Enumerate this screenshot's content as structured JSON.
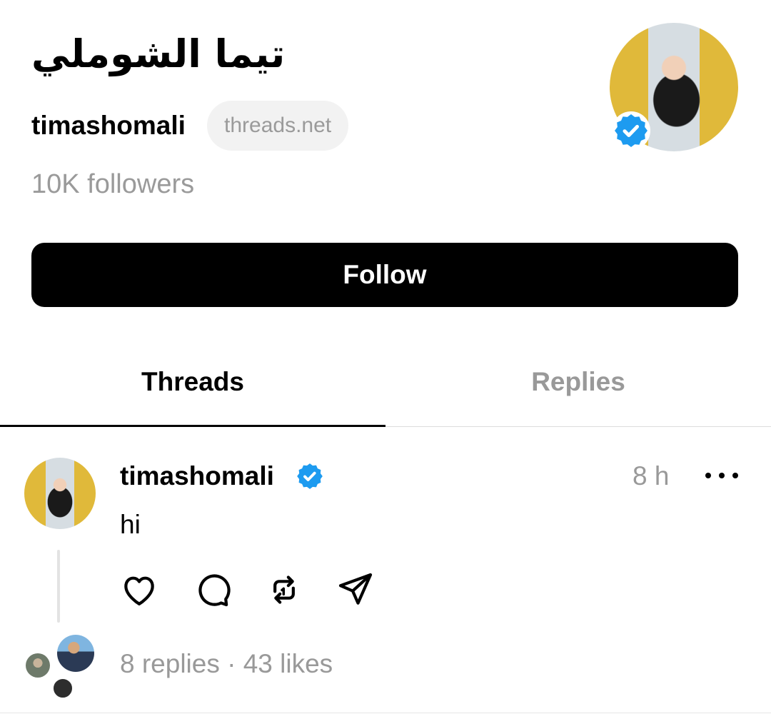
{
  "profile": {
    "display_name": "تيما الشوملي",
    "handle": "timashomali",
    "domain_badge": "threads.net",
    "followers": "10K followers",
    "follow_label": "Follow",
    "verified_color": "#1d9bf0"
  },
  "tabs": [
    {
      "label": "Threads",
      "active": true
    },
    {
      "label": "Replies",
      "active": false
    }
  ],
  "post": {
    "author": "timashomali",
    "time": "8 h",
    "text": "hi",
    "stats": "8 replies · 43 likes",
    "actions": [
      "heart-icon",
      "comment-icon",
      "repost-icon",
      "share-icon"
    ]
  }
}
